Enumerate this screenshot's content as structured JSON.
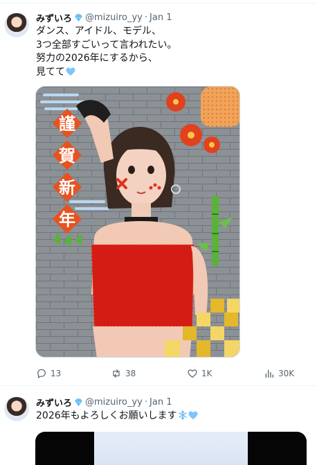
{
  "tweets": [
    {
      "name": "みずいろ",
      "badge_icon": "diamond-icon",
      "handle": "@mizuiro_yy",
      "separator": "·",
      "date": "Jan 1",
      "lines": [
        "ダンス、アイドル、モデル、",
        "3つ全部すごいって言われたい。",
        "努力の2026年にするから、",
        "見てて"
      ],
      "trailing_emoji": "blue-heart-icon",
      "image": {
        "kind": "photo",
        "vertical_text": [
          "謹",
          "賀",
          "新",
          "年"
        ]
      },
      "stats": {
        "replies": "13",
        "retweets": "38",
        "likes": "1K",
        "views": "30K"
      }
    },
    {
      "name": "みずいろ",
      "badge_icon": "diamond-icon",
      "handle": "@mizuiro_yy",
      "separator": "·",
      "date": "Jan 1",
      "text": "2026年もよろしくお願いします",
      "trailing_emojis": [
        "snowflake-icon",
        "blue-heart-icon"
      ]
    }
  ],
  "colors": {
    "text": "#0f1419",
    "secondary": "#536471",
    "border": "#eff3f4",
    "badge": "#4fb3ff",
    "heart": "#7cc6ff"
  }
}
